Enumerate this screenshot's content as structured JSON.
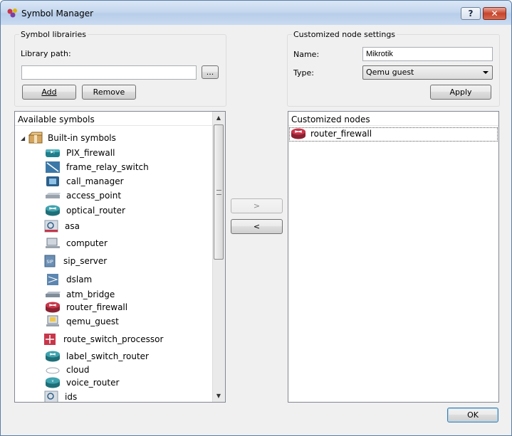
{
  "window": {
    "title": "Symbol Manager",
    "help_label": "?",
    "close_label": "✕"
  },
  "libraries": {
    "group_title": "Symbol librairies",
    "path_label": "Library path:",
    "path_value": "",
    "browse_label": "...",
    "add_label": "Add",
    "remove_label": "Remove"
  },
  "node_settings": {
    "group_title": "Customized node settings",
    "name_label": "Name:",
    "name_value": "Mikrotik",
    "type_label": "Type:",
    "type_value": "Qemu guest",
    "apply_label": "Apply"
  },
  "available": {
    "header": "Available symbols",
    "root": {
      "label": "Built-in symbols",
      "icon": "package-icon"
    },
    "items": [
      {
        "label": "PIX_firewall",
        "icon": "pix-firewall-icon"
      },
      {
        "label": "frame_relay_switch",
        "icon": "frame-relay-switch-icon"
      },
      {
        "label": "call_manager",
        "icon": "call-manager-icon"
      },
      {
        "label": "access_point",
        "icon": "access-point-icon"
      },
      {
        "label": "optical_router",
        "icon": "optical-router-icon"
      },
      {
        "label": "asa",
        "icon": "asa-icon"
      },
      {
        "label": "computer",
        "icon": "computer-icon"
      },
      {
        "label": "sip_server",
        "icon": "sip-server-icon"
      },
      {
        "label": "dslam",
        "icon": "dslam-icon"
      },
      {
        "label": "atm_bridge",
        "icon": "atm-bridge-icon"
      },
      {
        "label": "router_firewall",
        "icon": "router-firewall-icon"
      },
      {
        "label": "qemu_guest",
        "icon": "qemu-guest-icon"
      },
      {
        "label": "route_switch_processor",
        "icon": "route-switch-processor-icon"
      },
      {
        "label": "label_switch_router",
        "icon": "label-switch-router-icon"
      },
      {
        "label": "cloud",
        "icon": "cloud-icon"
      },
      {
        "label": "voice_router",
        "icon": "voice-router-icon"
      },
      {
        "label": "ids",
        "icon": "ids-icon"
      }
    ]
  },
  "transfer": {
    "add_label": ">",
    "remove_label": "<"
  },
  "customized": {
    "header": "Customized nodes",
    "items": [
      {
        "label": "router_firewall",
        "icon": "router-firewall-icon"
      }
    ]
  },
  "footer": {
    "ok_label": "OK"
  },
  "colors": {
    "title_bar": "#c5d7ee",
    "router_red": "#c8364a",
    "device_teal": "#1f7f8c"
  }
}
